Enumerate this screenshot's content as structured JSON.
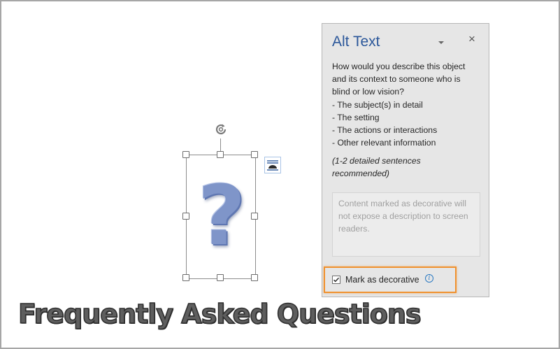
{
  "document": {
    "heading": "Frequently Asked Questions",
    "image": {
      "glyph": "?",
      "glyph_color": "#7f95c9",
      "rotate_icon": "rotate-handle-icon",
      "layout_options_icon": "layout-options-icon"
    }
  },
  "alt_text_pane": {
    "title": "Alt Text",
    "title_color": "#2b579a",
    "dropdown_icon": "chevron-down-icon",
    "close_icon": "close-icon",
    "close_glyph": "×",
    "description": {
      "line1": "How would you describe this object",
      "line2": "and its context to someone who is",
      "line3": "blind or low vision?",
      "bullet1": "- The subject(s) in detail",
      "bullet2": "- The setting",
      "bullet3": "- The actions or interactions",
      "bullet4": "- Other relevant information"
    },
    "hint_line1": "(1-2 detailed sentences",
    "hint_line2": "recommended)",
    "textarea_placeholder": "Content marked as decorative will not expose a description to screen readers.",
    "textarea_value": "",
    "mark_decorative": {
      "label": "Mark as decorative",
      "checked": true,
      "check_glyph": "✓",
      "info_icon": "info-icon",
      "info_glyph": "i",
      "highlight_color": "#f0912e"
    }
  }
}
